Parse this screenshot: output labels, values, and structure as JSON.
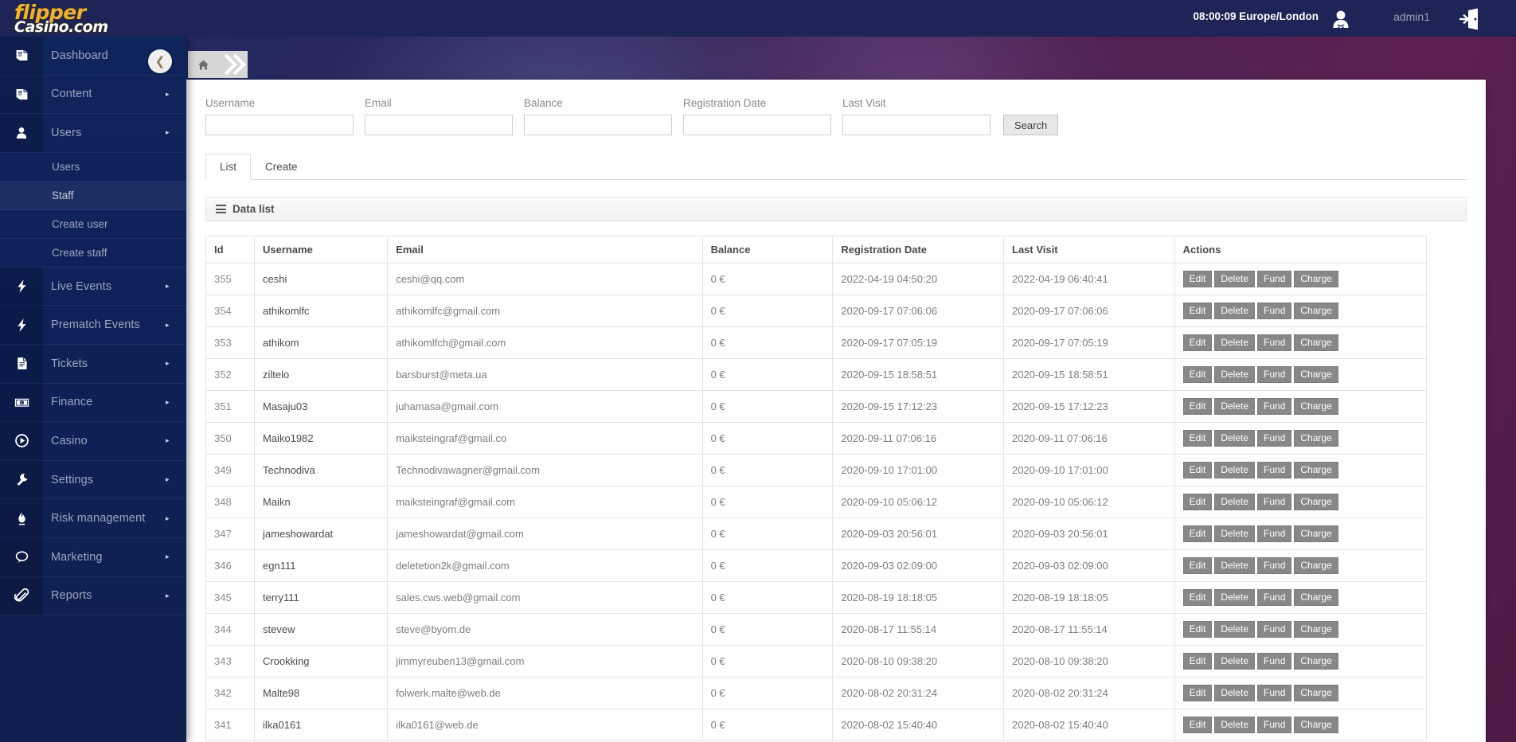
{
  "brand": {
    "logo_line1": "flipper",
    "logo_line2": "Casino.com"
  },
  "header": {
    "clock": "08:00:09 Europe/London",
    "username": "admin1",
    "avatar_icon": "user-avatar-icon",
    "logout_icon": "logout-door-icon"
  },
  "sidebar": {
    "toggle_icon": "chevron-left-icon",
    "items": [
      {
        "label": "Dashboard",
        "icon": "book-icon",
        "arrow": "▸"
      },
      {
        "label": "Content",
        "icon": "book-icon",
        "arrow": "▸"
      },
      {
        "label": "Users",
        "icon": "user-icon",
        "arrow": "▸"
      },
      {
        "label": "Live Events",
        "icon": "bolt-icon",
        "arrow": "▸"
      },
      {
        "label": "Prematch Events",
        "icon": "bolt-icon",
        "arrow": "▸"
      },
      {
        "label": "Tickets",
        "icon": "document-icon",
        "arrow": "▸"
      },
      {
        "label": "Finance",
        "icon": "money-icon",
        "arrow": "▸"
      },
      {
        "label": "Casino",
        "icon": "play-icon",
        "arrow": "▸"
      },
      {
        "label": "Settings",
        "icon": "wrench-icon",
        "arrow": "▸"
      },
      {
        "label": "Risk management",
        "icon": "flame-icon",
        "arrow": "▸"
      },
      {
        "label": "Marketing",
        "icon": "chat-icon",
        "arrow": "▸"
      },
      {
        "label": "Reports",
        "icon": "clip-icon",
        "arrow": "▸"
      }
    ],
    "users_submenu": [
      {
        "label": "Users",
        "active": false
      },
      {
        "label": "Staff",
        "active": true
      },
      {
        "label": "Create user",
        "active": false
      },
      {
        "label": "Create staff",
        "active": false
      }
    ]
  },
  "breadcrumb": {
    "home_icon": "home-icon",
    "chevron_icon": "double-chevron-right-icon"
  },
  "filters": {
    "fields": [
      {
        "label": "Username",
        "value": "",
        "placeholder": ""
      },
      {
        "label": "Email",
        "value": "",
        "placeholder": ""
      },
      {
        "label": "Balance",
        "value": "",
        "placeholder": ""
      },
      {
        "label": "Registration Date",
        "value": "",
        "placeholder": ""
      },
      {
        "label": "Last Visit",
        "value": "",
        "placeholder": ""
      }
    ],
    "search_label": "Search"
  },
  "tabs": [
    {
      "label": "List",
      "active": true
    },
    {
      "label": "Create",
      "active": false
    }
  ],
  "datalist": {
    "title": "Data list",
    "burger_icon": "hamburger-icon",
    "columns": [
      "Id",
      "Username",
      "Email",
      "Balance",
      "Registration Date",
      "Last Visit",
      "Actions"
    ],
    "action_labels": [
      "Edit",
      "Delete",
      "Fund",
      "Charge"
    ],
    "rows": [
      {
        "id": "355",
        "username": "ceshi",
        "email": "ceshi@qq.com",
        "balance": "0 €",
        "registration": "2022-04-19 04:50:20",
        "last_visit": "2022-04-19 06:40:41"
      },
      {
        "id": "354",
        "username": "athikomlfc",
        "email": "athikomlfc@gmail.com",
        "balance": "0 €",
        "registration": "2020-09-17 07:06:06",
        "last_visit": "2020-09-17 07:06:06"
      },
      {
        "id": "353",
        "username": "athikom",
        "email": "athikomlfch@gmail.com",
        "balance": "0 €",
        "registration": "2020-09-17 07:05:19",
        "last_visit": "2020-09-17 07:05:19"
      },
      {
        "id": "352",
        "username": "ziltelo",
        "email": "barsburst@meta.ua",
        "balance": "0 €",
        "registration": "2020-09-15 18:58:51",
        "last_visit": "2020-09-15 18:58:51"
      },
      {
        "id": "351",
        "username": "Masaju03",
        "email": "juhamasa@gmail.com",
        "balance": "0 €",
        "registration": "2020-09-15 17:12:23",
        "last_visit": "2020-09-15 17:12:23"
      },
      {
        "id": "350",
        "username": "Maiko1982",
        "email": "maiksteingraf@gmail.co",
        "balance": "0 €",
        "registration": "2020-09-11 07:06:16",
        "last_visit": "2020-09-11 07:06:16"
      },
      {
        "id": "349",
        "username": "Technodiva",
        "email": "Technodivawagner@gmail.com",
        "balance": "0 €",
        "registration": "2020-09-10 17:01:00",
        "last_visit": "2020-09-10 17:01:00"
      },
      {
        "id": "348",
        "username": "Maikn",
        "email": "maiksteingraf@gmail.com",
        "balance": "0 €",
        "registration": "2020-09-10 05:06:12",
        "last_visit": "2020-09-10 05:06:12"
      },
      {
        "id": "347",
        "username": "jameshowardat",
        "email": "jameshowardat@gmail.com",
        "balance": "0 €",
        "registration": "2020-09-03 20:56:01",
        "last_visit": "2020-09-03 20:56:01"
      },
      {
        "id": "346",
        "username": "egn111",
        "email": "deletetion2k@gmail.com",
        "balance": "0 €",
        "registration": "2020-09-03 02:09:00",
        "last_visit": "2020-09-03 02:09:00"
      },
      {
        "id": "345",
        "username": "terry111",
        "email": "sales.cws.web@gmail.com",
        "balance": "0 €",
        "registration": "2020-08-19 18:18:05",
        "last_visit": "2020-08-19 18:18:05"
      },
      {
        "id": "344",
        "username": "stevew",
        "email": "steve@byom.de",
        "balance": "0 €",
        "registration": "2020-08-17 11:55:14",
        "last_visit": "2020-08-17 11:55:14"
      },
      {
        "id": "343",
        "username": "Crookking",
        "email": "jimmyreuben13@gmail.com",
        "balance": "0 €",
        "registration": "2020-08-10 09:38:20",
        "last_visit": "2020-08-10 09:38:20"
      },
      {
        "id": "342",
        "username": "Malte98",
        "email": "folwerk.malte@web.de",
        "balance": "0 €",
        "registration": "2020-08-02 20:31:24",
        "last_visit": "2020-08-02 20:31:24"
      },
      {
        "id": "341",
        "username": "ilka0161",
        "email": "ilka0161@web.de",
        "balance": "0 €",
        "registration": "2020-08-02 15:40:40",
        "last_visit": "2020-08-02 15:40:40"
      }
    ]
  },
  "colors": {
    "topbar": "#1e2455",
    "sidebar": "#10245c",
    "logo_yellow": "#f0b13a",
    "backdrop_purple": "#5c2050",
    "action_button": "#888888"
  }
}
